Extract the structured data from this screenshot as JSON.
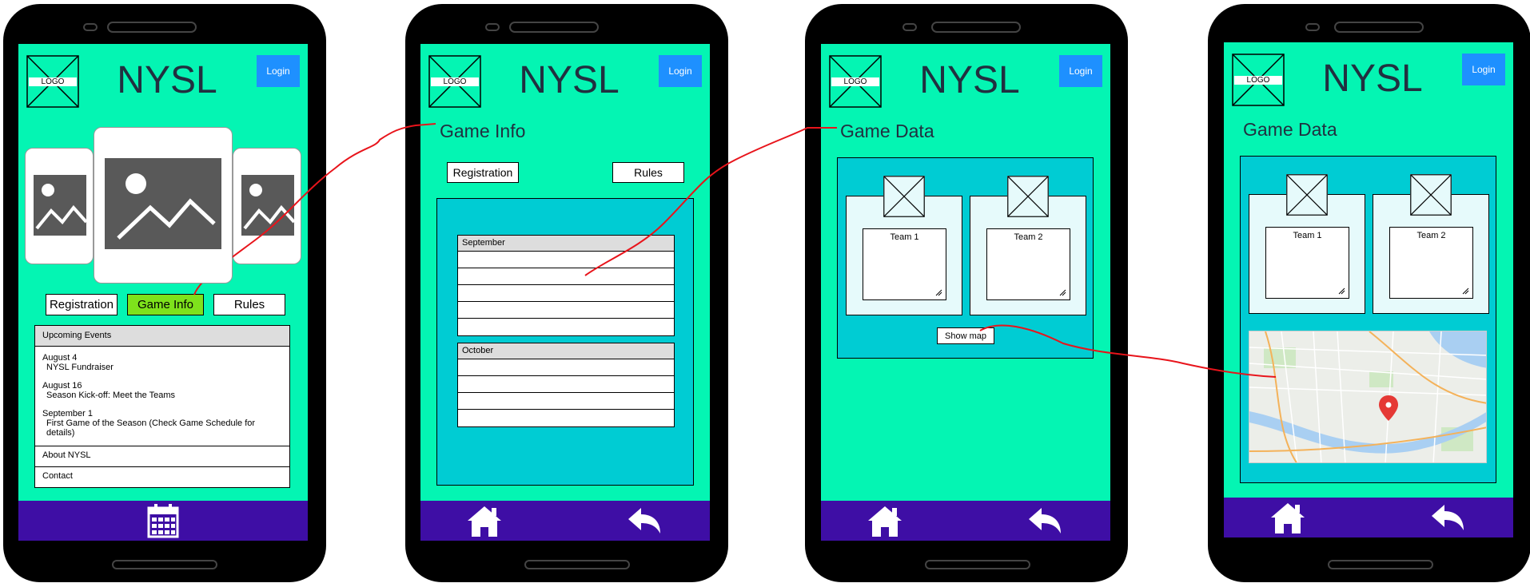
{
  "app": {
    "brand": "NYSL",
    "logo_text": "LOGO",
    "login_label": "Login"
  },
  "screen1": {
    "nav": [
      "Registration",
      "Game Info",
      "Rules"
    ],
    "active_nav": "Game Info",
    "events_header": "Upcoming Events",
    "events": [
      {
        "date": "August 4",
        "title": "NYSL Fundraiser"
      },
      {
        "date": "August 16",
        "title": "Season Kick-off: Meet the Teams"
      },
      {
        "date": "September 1",
        "title": "First Game of the Season (Check Game Schedule for details)"
      }
    ],
    "links": [
      "About NYSL",
      "Contact"
    ],
    "footer_icons": [
      "calendar-icon"
    ]
  },
  "screen2": {
    "title": "Game Info",
    "buttons": [
      "Registration",
      "Rules"
    ],
    "months": [
      "September",
      "October"
    ],
    "footer_icons": [
      "home-icon",
      "back-arrow-icon"
    ]
  },
  "screen3": {
    "title": "Game Data",
    "teams": [
      "Team 1",
      "Team 2"
    ],
    "show_map_label": "Show map",
    "footer_icons": [
      "home-icon",
      "back-arrow-icon"
    ]
  },
  "screen4": {
    "title": "Game Data",
    "teams": [
      "Team 1",
      "Team 2"
    ],
    "map_icon": "map-pin-icon",
    "footer_icons": [
      "home-icon",
      "back-arrow-icon"
    ]
  },
  "colors": {
    "screen_bg": "#04f5b3",
    "footer_bg": "#3e0ea5",
    "login_bg": "#1e90ff",
    "active_button": "#7ee21c",
    "panel_bg": "#00ccd3",
    "flow_line": "#e8141b"
  }
}
